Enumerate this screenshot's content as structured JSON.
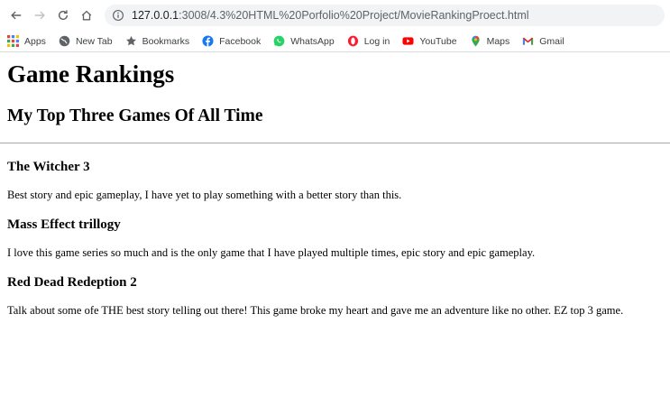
{
  "browser": {
    "url_host": "127.0.0.1",
    "url_rest": ":3008/4.3%20HTML%20Porfolio%20Project/MovieRankingProect.html",
    "bookmarks": [
      {
        "label": "Apps",
        "icon": "apps-grid-icon"
      },
      {
        "label": "New Tab",
        "icon": "globe-icon"
      },
      {
        "label": "Bookmarks",
        "icon": "star-icon"
      },
      {
        "label": "Facebook",
        "icon": "facebook-icon"
      },
      {
        "label": "WhatsApp",
        "icon": "whatsapp-icon"
      },
      {
        "label": "Log in",
        "icon": "opera-icon"
      },
      {
        "label": "YouTube",
        "icon": "youtube-icon"
      },
      {
        "label": "Maps",
        "icon": "maps-pin-icon"
      },
      {
        "label": "Gmail",
        "icon": "gmail-icon"
      }
    ]
  },
  "page": {
    "title": "Game Rankings",
    "subtitle": "My Top Three Games Of All Time",
    "games": [
      {
        "name": "The Witcher 3",
        "description": "Best story and epic gameplay, I have yet to play something with a better story than this."
      },
      {
        "name": "Mass Effect trillogy",
        "description": "I love this game series so much and is the only game that I have played multiple times, epic story and epic gameplay."
      },
      {
        "name": "Red Dead Redeption 2",
        "description": "Talk about some ofe THE best story telling out there! This game broke my heart and gave me an adventure like no other. EZ top 3 game."
      }
    ]
  },
  "colors": {
    "facebook": "#1877f2",
    "whatsapp": "#25d366",
    "opera": "#ff1b2d",
    "youtube": "#ff0000",
    "gmail": "#d93025"
  }
}
